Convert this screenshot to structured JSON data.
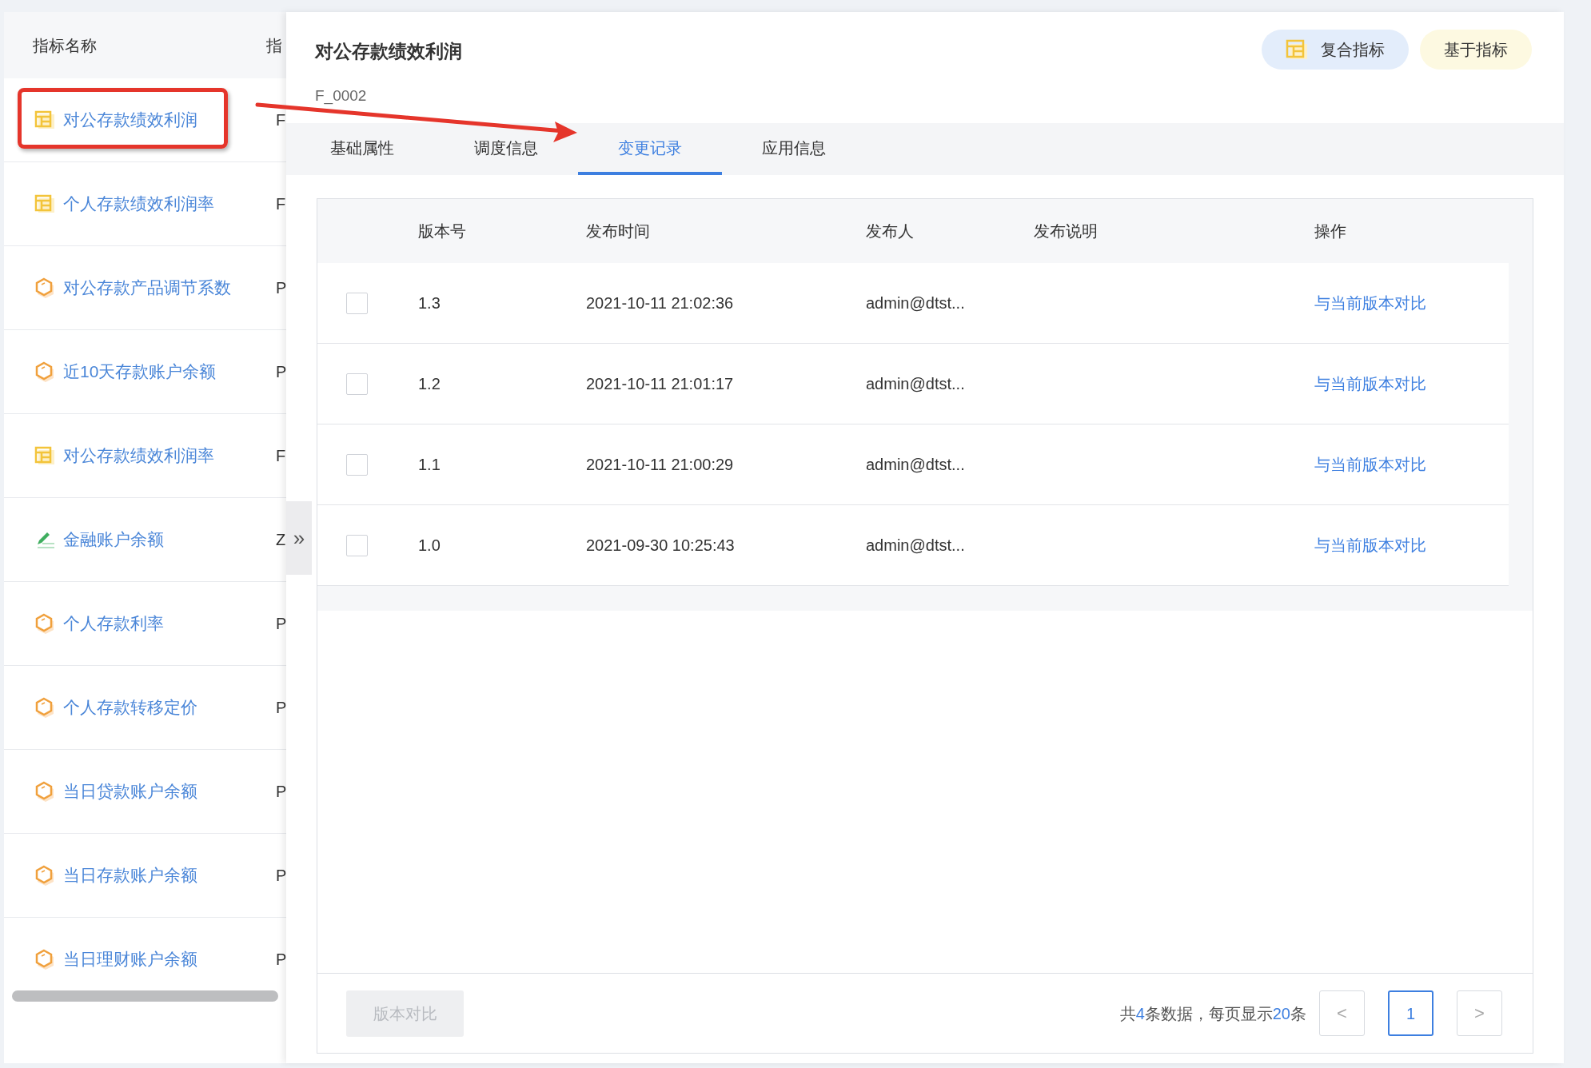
{
  "list": {
    "columns": [
      "指标名称",
      "指"
    ],
    "items": [
      {
        "name": "对公存款绩效利润",
        "code": "F",
        "kind": "composite"
      },
      {
        "name": "个人存款绩效利润率",
        "code": "F",
        "kind": "composite"
      },
      {
        "name": "对公存款产品调节系数",
        "code": "P",
        "kind": "atomic"
      },
      {
        "name": "近10天存款账户余额",
        "code": "P",
        "kind": "atomic"
      },
      {
        "name": "对公存款绩效利润率",
        "code": "F",
        "kind": "composite"
      },
      {
        "name": "金融账户余额",
        "code": "Z",
        "kind": "custom"
      },
      {
        "name": "个人存款利率",
        "code": "P",
        "kind": "atomic"
      },
      {
        "name": "个人存款转移定价",
        "code": "P",
        "kind": "atomic"
      },
      {
        "name": "当日贷款账户余额",
        "code": "P",
        "kind": "atomic"
      },
      {
        "name": "当日存款账户余额",
        "code": "P",
        "kind": "atomic"
      },
      {
        "name": "当日理财账户余额",
        "code": "P",
        "kind": "atomic"
      }
    ]
  },
  "expand_toggle": "»",
  "detail": {
    "title": "对公存款绩效利润",
    "code": "F_0002",
    "badges": [
      {
        "label": "复合指标",
        "kind": "type"
      },
      {
        "label": "基于指标",
        "kind": "basis"
      }
    ],
    "tabs": [
      {
        "label": "基础属性",
        "selected": false
      },
      {
        "label": "调度信息",
        "selected": false
      },
      {
        "label": "变更记录",
        "selected": true
      },
      {
        "label": "应用信息",
        "selected": false
      }
    ],
    "table": {
      "columns": [
        "版本号",
        "发布时间",
        "发布人",
        "发布说明",
        "操作"
      ],
      "rows": [
        {
          "checked": false,
          "version": "1.3",
          "time": "2021-10-11 21:02:36",
          "publisher": "admin@dtst...",
          "action": "与当前版本对比"
        },
        {
          "checked": false,
          "version": "1.2",
          "time": "2021-10-11 21:01:17",
          "publisher": "admin@dtst...",
          "action": "与当前版本对比"
        },
        {
          "checked": false,
          "version": "1.1",
          "time": "2021-10-11 21:00:29",
          "publisher": "admin@dtst...",
          "action": "与当前版本对比"
        },
        {
          "checked": false,
          "version": "1.0",
          "time": "2021-09-30 10:25:43",
          "publisher": "admin@dtst...",
          "action": "与当前版本对比"
        }
      ]
    },
    "compare_button": {
      "label": "版本对比",
      "disabled": true
    },
    "pagination": {
      "prefix": "共",
      "total": "4",
      "middle": "条数据，每页显示",
      "page_size": "20",
      "suffix": "条",
      "prev": "<",
      "next": ">",
      "pages": [
        {
          "label": "1",
          "selected": true
        }
      ]
    }
  }
}
